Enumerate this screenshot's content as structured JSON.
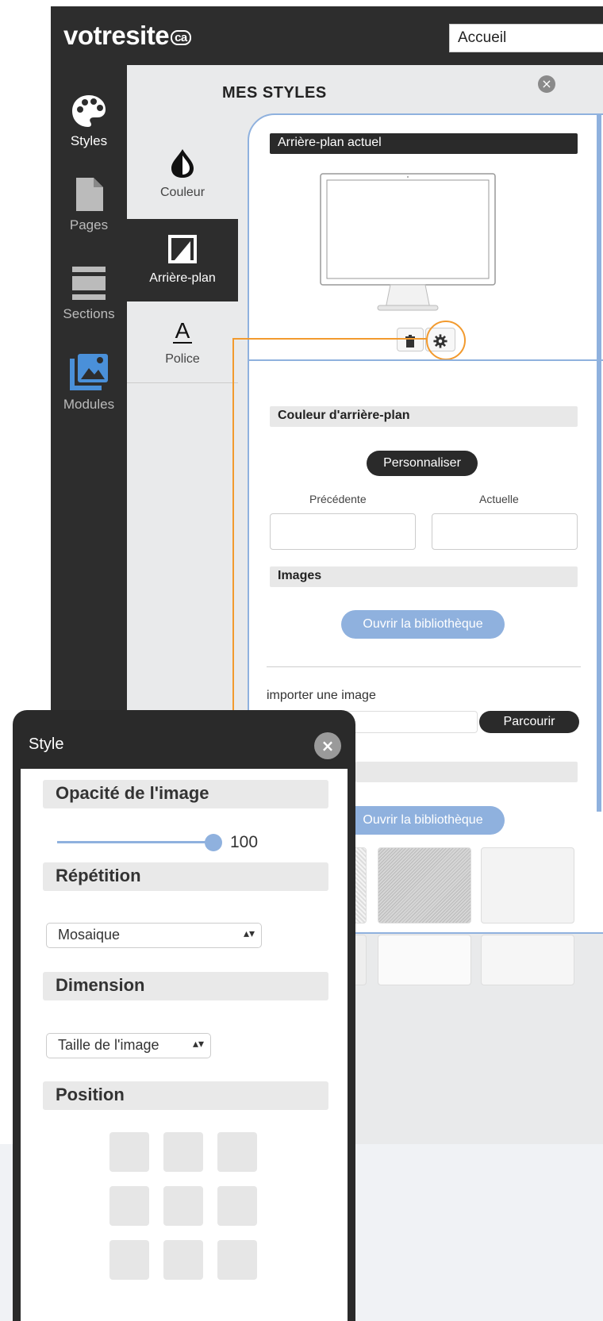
{
  "app": {
    "logo": "votresite",
    "logo_suffix": "ca",
    "page_selector": "Accueil"
  },
  "nav": {
    "items": [
      {
        "label": "Styles",
        "icon": "palette-icon"
      },
      {
        "label": "Pages",
        "icon": "page-icon"
      },
      {
        "label": "Sections",
        "icon": "sections-icon"
      },
      {
        "label": "Modules",
        "icon": "image-gallery-icon"
      }
    ]
  },
  "subnav": {
    "items": [
      {
        "label": "Couleur",
        "icon": "drop-icon"
      },
      {
        "label": "Arrière-plan",
        "icon": "background-icon"
      },
      {
        "label": "Police",
        "icon": "font-icon"
      }
    ]
  },
  "panel": {
    "title": "MES STYLES",
    "current_bg_heading": "Arrière-plan actuel",
    "bg_color_heading": "Couleur d'arrière-plan",
    "customize_button": "Personnaliser",
    "previous_label": "Précédente",
    "current_label": "Actuelle",
    "images_heading": "Images",
    "open_library_button": "Ouvrir la bibliothèque",
    "import_label": "importer une image",
    "browse_button": "Parcourir",
    "open_library_button_2": "Ouvrir la bibliothèque"
  },
  "popup": {
    "title": "Style",
    "opacity_heading": "Opacité de l'image",
    "opacity_value": "100",
    "repeat_heading": "Répétition",
    "repeat_value": "Mosaique",
    "dimension_heading": "Dimension",
    "dimension_value": "Taille de l'image",
    "position_heading": "Position"
  },
  "colors": {
    "dark": "#2d2d2d",
    "accent_blue": "#8fb1de",
    "highlight_orange": "#f29a2e"
  }
}
